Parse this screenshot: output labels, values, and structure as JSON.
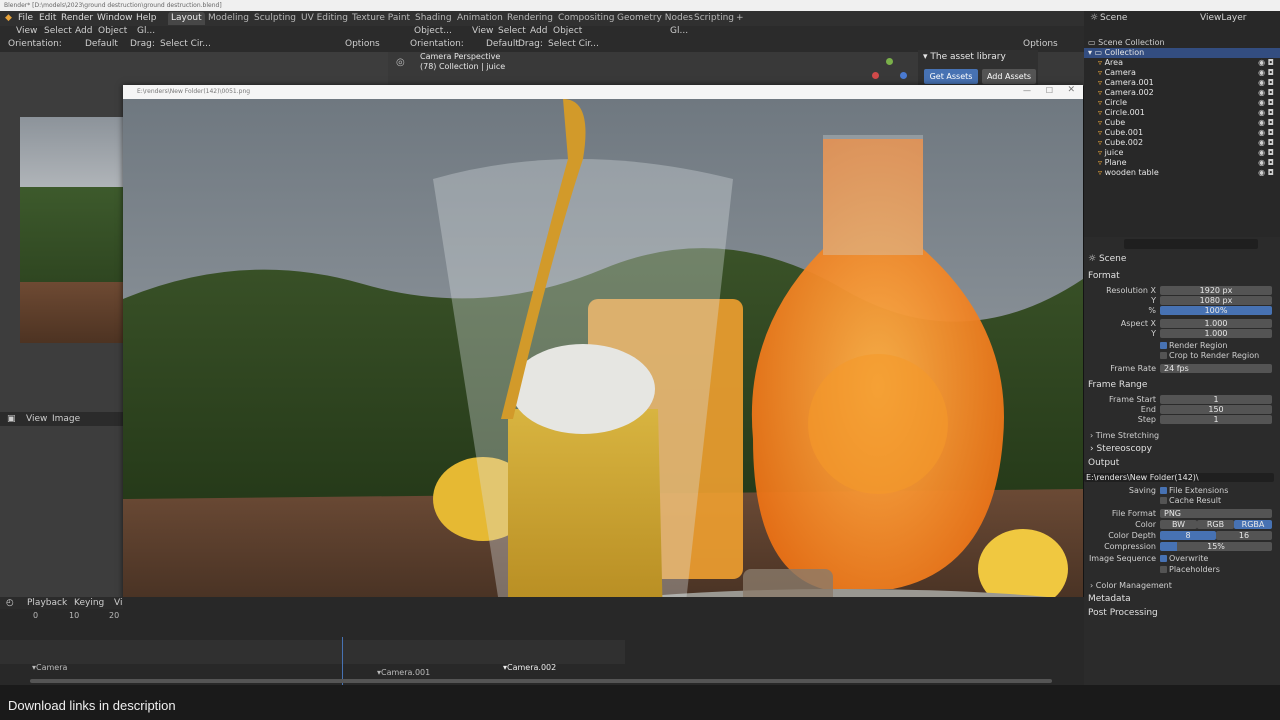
{
  "window": {
    "title": "Blender* [D:\\models\\2023\\ground destruction\\ground destruction.blend]"
  },
  "menu": {
    "file": "File",
    "edit": "Edit",
    "render": "Render",
    "window": "Window",
    "help": "Help"
  },
  "workspaces": [
    "Layout",
    "Modeling",
    "Sculpting",
    "UV Editing",
    "Texture Paint",
    "Shading",
    "Animation",
    "Rendering",
    "Compositing",
    "Geometry Nodes",
    "Scripting"
  ],
  "left_header": {
    "view": "View",
    "select": "Select",
    "add": "Add",
    "object": "Object",
    "orientation": "Orientation:",
    "orientation_val": "Default",
    "drag": "Drag:",
    "drag_val": "Select Cir...",
    "options": "Options"
  },
  "right_header": {
    "mode": "Object...",
    "view": "View",
    "select": "Select",
    "add": "Add",
    "object": "Object",
    "orientation": "Orientation:",
    "orientation_val": "Default",
    "drag": "Drag:",
    "drag_val": "Select Cir...",
    "options": "Options",
    "gizmo": "Gl..."
  },
  "viewport": {
    "camera_line1": "Camera Perspective",
    "camera_line2": "(78) Collection | juice"
  },
  "asset_panel": {
    "title": "The asset library",
    "get": "Get Assets",
    "add": "Add Assets"
  },
  "image_editor": {
    "title": "E:\\renders\\New Folder(142)\\0051.png",
    "view": "View",
    "image": "Image"
  },
  "outliner": {
    "scene": "Scene",
    "view_layer": "ViewLayer",
    "scene_collection": "Scene Collection",
    "collection": "Collection",
    "objects": [
      "Area",
      "Camera",
      "Camera.001",
      "Camera.002",
      "Circle",
      "Circle.001",
      "Cube",
      "Cube.001",
      "Cube.002",
      "juice",
      "Plane",
      "wooden table"
    ]
  },
  "properties": {
    "scene": "Scene",
    "format": "Format",
    "res_x_label": "Resolution X",
    "res_x": "1920 px",
    "res_y_label": "Y",
    "res_y": "1080 px",
    "pct_label": "%",
    "pct": "100%",
    "aspect_x_label": "Aspect X",
    "aspect_x": "1.000",
    "aspect_y_label": "Y",
    "aspect_y": "1.000",
    "render_region": "Render Region",
    "crop": "Crop to Render Region",
    "frame_rate_label": "Frame Rate",
    "frame_rate": "24 fps",
    "frame_range": "Frame Range",
    "frame_start_label": "Frame Start",
    "frame_start": "1",
    "end_label": "End",
    "end": "150",
    "step_label": "Step",
    "step": "1",
    "time_stretching": "Time Stretching",
    "stereoscopy": "Stereoscopy",
    "output": "Output",
    "path": "E:\\renders\\New Folder(142)\\",
    "saving_label": "Saving",
    "file_ext": "File Extensions",
    "cache": "Cache Result",
    "file_format_label": "File Format",
    "file_format": "PNG",
    "color_label": "Color",
    "bw": "BW",
    "rgb": "RGB",
    "rgba": "RGBA",
    "depth_label": "Color Depth",
    "d8": "8",
    "d16": "16",
    "compression_label": "Compression",
    "compression": "15%",
    "seq_label": "Image Sequence",
    "overwrite": "Overwrite",
    "placeholders": "Placeholders",
    "color_mgmt": "Color Management",
    "metadata": "Metadata",
    "post": "Post Processing"
  },
  "timeline": {
    "playback": "Playback",
    "keying": "Keying",
    "view": "Vi",
    "ticks": [
      "0",
      "10",
      "20"
    ],
    "markers": [
      "Camera",
      "Camera.001",
      "Camera.002"
    ]
  },
  "caption": "Download links in description",
  "colors": {
    "accent": "#4772b3",
    "orange_active": "#e8a33a"
  }
}
